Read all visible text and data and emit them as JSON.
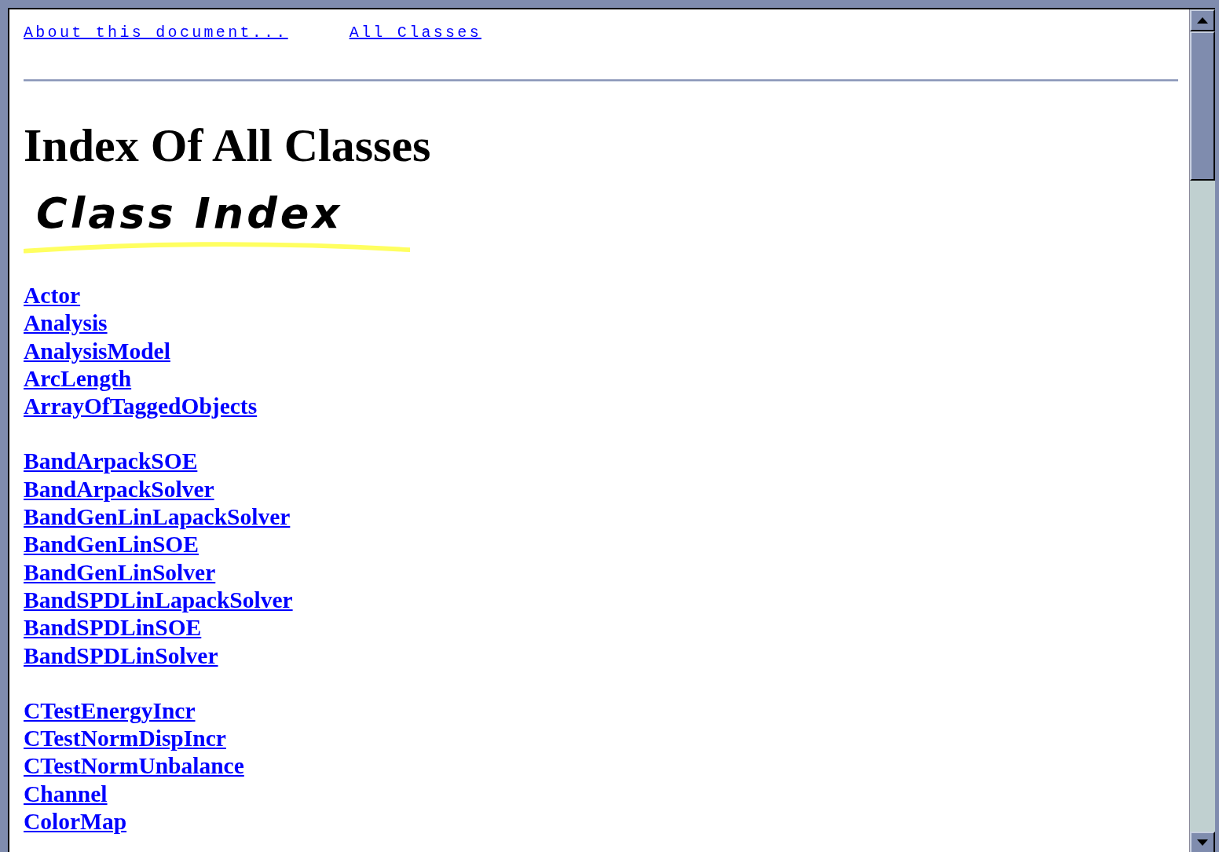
{
  "nav_links": [
    "About this document...",
    "All Classes"
  ],
  "heading": "Index Of All Classes",
  "logo_text": "Class Index",
  "class_groups": [
    [
      "Actor",
      "Analysis",
      "AnalysisModel",
      "ArcLength",
      "ArrayOfTaggedObjects"
    ],
    [
      "BandArpackSOE",
      "BandArpackSolver",
      "BandGenLinLapackSolver",
      "BandGenLinSOE",
      "BandGenLinSolver",
      "BandSPDLinLapackSolver",
      "BandSPDLinSOE",
      "BandSPDLinSolver"
    ],
    [
      "CTestEnergyIncr",
      "CTestNormDispIncr",
      "CTestNormUnbalance",
      "Channel",
      "ColorMap"
    ]
  ]
}
